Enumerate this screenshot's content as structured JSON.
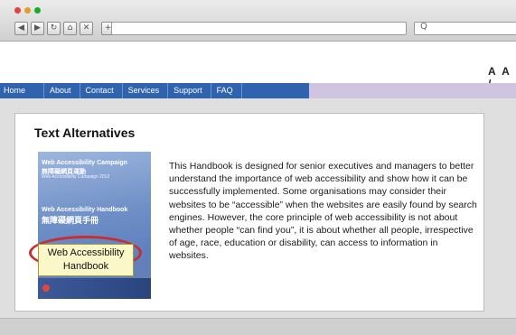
{
  "browser": {
    "nav_buttons": [
      {
        "name": "back-button",
        "glyph": "◀"
      },
      {
        "name": "forward-button",
        "glyph": "▶"
      },
      {
        "name": "reload-button",
        "glyph": "↻"
      },
      {
        "name": "home-button",
        "glyph": "⌂"
      },
      {
        "name": "stop-button",
        "glyph": "✕"
      }
    ],
    "new_tab_glyph": "+",
    "search_glyph": "Q"
  },
  "site": {
    "text_size_control": "A A /",
    "menu": [
      "Home",
      "About",
      "Contact",
      "Services",
      "Support",
      "FAQ"
    ],
    "menu_color": "#2f63ae",
    "menu_accent": "#cfc5e0"
  },
  "section": {
    "heading": "Text Alternatives",
    "book_cover": {
      "campaign_en": "Web Accessibility Campaign",
      "campaign_zh": "無障礙網頁運動",
      "small_text": "Web Accessibility Campaign 2012",
      "handbook_en": "Web Accessibility Handbook",
      "handbook_zh": "無障礙網頁手冊"
    },
    "alt_text_tooltip": "Web Accessibility Handbook",
    "paragraph": "This Handbook is designed for senior executives and managers to better understand the importance of web accessibility and show how it can be successfully implemented. Some organisations may consider their websites to be “accessible” when the websites are easily found by search engines. However, the core principle of web accessibility is not about whether people “can find you”, it is about whether all people, irrespective of age, race, education or disability, can access to information in websites."
  }
}
